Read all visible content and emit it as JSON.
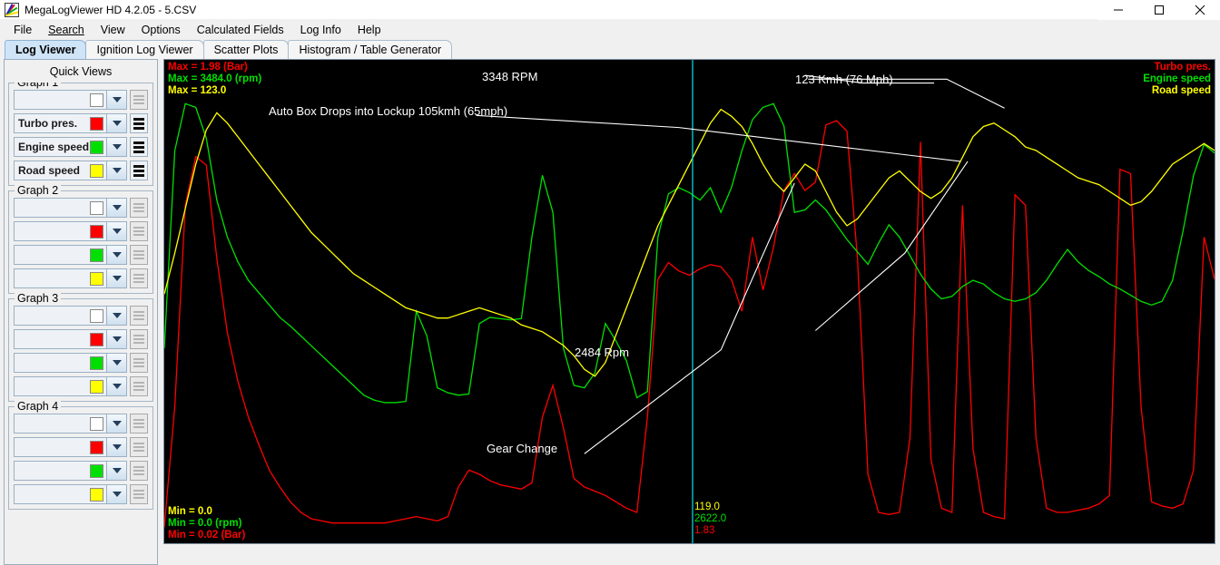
{
  "window": {
    "title": "MegaLogViewer HD 4.2.05 - 5.CSV",
    "icon": "app-logo-icon",
    "minimize": "—",
    "maximize": "□",
    "close": "✕"
  },
  "menubar": {
    "items": [
      {
        "label": "File"
      },
      {
        "label": "Search"
      },
      {
        "label": "View"
      },
      {
        "label": "Options"
      },
      {
        "label": "Calculated Fields"
      },
      {
        "label": "Log Info"
      },
      {
        "label": "Help"
      }
    ]
  },
  "tabs": [
    {
      "label": "Log Viewer",
      "active": true
    },
    {
      "label": "Ignition Log Viewer",
      "active": false
    },
    {
      "label": "Scatter Plots",
      "active": false
    },
    {
      "label": "Histogram / Table Generator",
      "active": false
    }
  ],
  "sidebar": {
    "title": "Quick Views",
    "groups": [
      {
        "label": "Graph 1",
        "channels": [
          {
            "name": "",
            "color": "#ffffff",
            "enabled": false
          },
          {
            "name": "Turbo pres.",
            "color": "#ff0000",
            "enabled": true
          },
          {
            "name": "Engine speed",
            "color": "#00e000",
            "enabled": true
          },
          {
            "name": "Road speed",
            "color": "#ffff00",
            "enabled": true
          }
        ]
      },
      {
        "label": "Graph 2",
        "channels": [
          {
            "name": "",
            "color": "#ffffff",
            "enabled": false
          },
          {
            "name": "",
            "color": "#ff0000",
            "enabled": false
          },
          {
            "name": "",
            "color": "#00e000",
            "enabled": false
          },
          {
            "name": "",
            "color": "#ffff00",
            "enabled": false
          }
        ]
      },
      {
        "label": "Graph 3",
        "channels": [
          {
            "name": "",
            "color": "#ffffff",
            "enabled": false
          },
          {
            "name": "",
            "color": "#ff0000",
            "enabled": false
          },
          {
            "name": "",
            "color": "#00e000",
            "enabled": false
          },
          {
            "name": "",
            "color": "#ffff00",
            "enabled": false
          }
        ]
      },
      {
        "label": "Graph 4",
        "channels": [
          {
            "name": "",
            "color": "#ffffff",
            "enabled": false
          },
          {
            "name": "",
            "color": "#ff0000",
            "enabled": false
          },
          {
            "name": "",
            "color": "#00e000",
            "enabled": false
          },
          {
            "name": "",
            "color": "#ffff00",
            "enabled": false
          }
        ]
      }
    ]
  },
  "chart_data": {
    "type": "line",
    "title": "",
    "xlabel": "",
    "ylabel": "",
    "background": "#000000",
    "grid": false,
    "legend_position": "top-right",
    "x": [
      0,
      1,
      2,
      3,
      4,
      5,
      6,
      7,
      8,
      9,
      10,
      11,
      12,
      13,
      14,
      15,
      16,
      17,
      18,
      19,
      20,
      21,
      22,
      23,
      24,
      25,
      26,
      27,
      28,
      29,
      30,
      31,
      32,
      33,
      34,
      35,
      36,
      37,
      38,
      39,
      40,
      41,
      42,
      43,
      44,
      45,
      46,
      47,
      48,
      49,
      50,
      51,
      52,
      53,
      54,
      55,
      56,
      57,
      58,
      59,
      60,
      61,
      62,
      63,
      64,
      65,
      66,
      67,
      68,
      69,
      70,
      71,
      72,
      73,
      74,
      75,
      76,
      77,
      78,
      79,
      80,
      81,
      82,
      83,
      84,
      85,
      86,
      87,
      88,
      89,
      90,
      91,
      92,
      93,
      94,
      95,
      96,
      97,
      98,
      99,
      100
    ],
    "xlim": [
      0,
      100
    ],
    "series": [
      {
        "name": "Turbo pres.",
        "color": "#ff0000",
        "unit": "Bar",
        "max": 1.98,
        "min": 0.02,
        "cursor_value": 1.83,
        "ylim": [
          0,
          2.1
        ],
        "values": [
          0.03,
          0.6,
          1.55,
          1.78,
          1.74,
          1.3,
          0.95,
          0.72,
          0.55,
          0.42,
          0.3,
          0.22,
          0.15,
          0.1,
          0.07,
          0.06,
          0.05,
          0.05,
          0.05,
          0.05,
          0.05,
          0.05,
          0.06,
          0.07,
          0.08,
          0.07,
          0.06,
          0.08,
          0.22,
          0.3,
          0.28,
          0.25,
          0.23,
          0.22,
          0.21,
          0.24,
          0.55,
          0.7,
          0.5,
          0.26,
          0.22,
          0.2,
          0.18,
          0.15,
          0.12,
          0.1,
          0.55,
          1.2,
          1.28,
          1.24,
          1.22,
          1.25,
          1.27,
          1.26,
          1.2,
          1.05,
          1.4,
          1.15,
          1.35,
          1.62,
          1.7,
          1.62,
          1.66,
          1.93,
          1.95,
          1.9,
          1.3,
          0.28,
          0.1,
          0.09,
          0.1,
          0.45,
          1.85,
          0.35,
          0.12,
          0.1,
          1.55,
          0.4,
          0.1,
          0.08,
          0.07,
          1.6,
          1.55,
          0.45,
          0.12,
          0.1,
          0.1,
          0.11,
          0.12,
          0.14,
          0.18,
          1.72,
          1.7,
          0.6,
          0.15,
          0.13,
          0.12,
          0.14,
          0.3,
          1.4,
          1.2
        ]
      },
      {
        "name": "Engine speed",
        "color": "#00e000",
        "unit": "rpm",
        "max": 3484.0,
        "min": 0.0,
        "cursor_value": 2622.0,
        "ylim": [
          0,
          3600
        ],
        "values": [
          1500,
          3100,
          3480,
          3450,
          3200,
          2700,
          2400,
          2200,
          2050,
          1950,
          1850,
          1750,
          1680,
          1600,
          1520,
          1440,
          1360,
          1280,
          1200,
          1120,
          1080,
          1060,
          1060,
          1070,
          1800,
          1600,
          1180,
          1140,
          1120,
          1130,
          1700,
          1750,
          1740,
          1730,
          1740,
          2400,
          2900,
          2600,
          1500,
          1200,
          1180,
          1300,
          1700,
          1560,
          1400,
          1100,
          1150,
          2400,
          2750,
          2800,
          2760,
          2700,
          2800,
          2600,
          2800,
          3100,
          3350,
          3450,
          3480,
          3300,
          2600,
          2620,
          2700,
          2620,
          2500,
          2380,
          2280,
          2180,
          2350,
          2500,
          2400,
          2250,
          2100,
          1980,
          1900,
          1920,
          2000,
          2050,
          2020,
          1950,
          1900,
          1880,
          1900,
          1950,
          2050,
          2180,
          2300,
          2200,
          2130,
          2080,
          2020,
          1980,
          1930,
          1880,
          1850,
          1880,
          2050,
          2450,
          2900,
          3150,
          3080
        ]
      },
      {
        "name": "Road speed",
        "color": "#ffff00",
        "unit": "",
        "max": 123.0,
        "min": 0.0,
        "cursor_value": 119.0,
        "ylim": [
          0,
          130
        ],
        "values": [
          70,
          82,
          95,
          108,
          118,
          123,
          120,
          116,
          112,
          108,
          104,
          100,
          96,
          92,
          88,
          85,
          82,
          79,
          76,
          74,
          72,
          70,
          68,
          66,
          65,
          64,
          63,
          63,
          64,
          65,
          66,
          65,
          64,
          63,
          61,
          60,
          59,
          57,
          55,
          52,
          48,
          46,
          50,
          58,
          66,
          74,
          82,
          90,
          96,
          102,
          108,
          114,
          120,
          124,
          122,
          119,
          114,
          108,
          103,
          100,
          104,
          108,
          106,
          100,
          94,
          90,
          92,
          96,
          100,
          104,
          106,
          103,
          100,
          98,
          100,
          104,
          110,
          116,
          119,
          120,
          118,
          116,
          113,
          112,
          110,
          108,
          106,
          104,
          103,
          102,
          100,
          98,
          96,
          97,
          100,
          104,
          108,
          110,
          112,
          114,
          112
        ]
      }
    ],
    "cursor": {
      "x_fraction": 0.503,
      "color": "#00e5ee"
    },
    "stats_topleft": [
      {
        "text": "Max = 1.98 (Bar)",
        "color": "#ff0000"
      },
      {
        "text": "Max = 3484.0 (rpm)",
        "color": "#00e000"
      },
      {
        "text": "Max = 123.0",
        "color": "#ffff00"
      }
    ],
    "stats_bottomleft": [
      {
        "text": "Min = 0.0",
        "color": "#ffff00"
      },
      {
        "text": "Min = 0.0 (rpm)",
        "color": "#00e000"
      },
      {
        "text": "Min = 0.02 (Bar)",
        "color": "#ff0000"
      }
    ],
    "legend": [
      {
        "text": "Turbo pres.",
        "color": "#ff0000"
      },
      {
        "text": "Engine speed",
        "color": "#00e000"
      },
      {
        "text": "Road speed",
        "color": "#ffff00"
      }
    ],
    "cursor_readout": [
      {
        "text": "119.0",
        "color": "#ffff00"
      },
      {
        "text": "2622.0",
        "color": "#00e000"
      },
      {
        "text": "1.83",
        "color": "#ff0000"
      }
    ],
    "annotations": [
      {
        "text": "3348 RPM"
      },
      {
        "text": "Auto Box Drops into Lockup 105kmh (65mph)"
      },
      {
        "text": "123 Kmh (76 Mph)"
      },
      {
        "text": "2484 Rpm"
      },
      {
        "text": "Gear Change"
      }
    ]
  }
}
